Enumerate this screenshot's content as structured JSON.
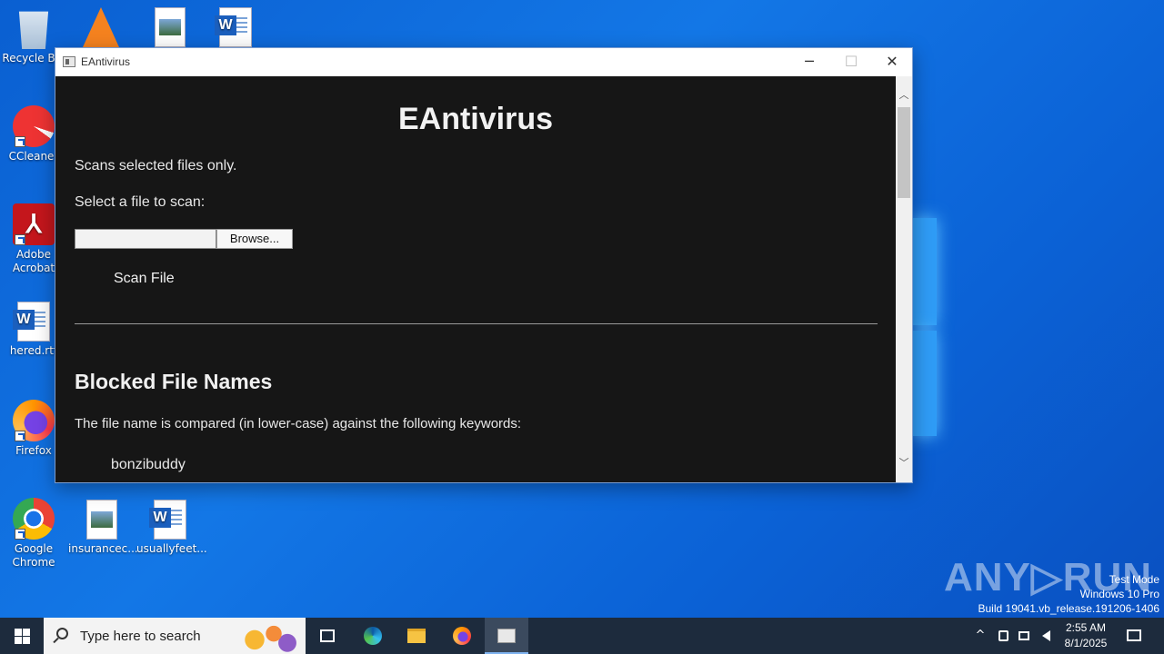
{
  "desktop": {
    "icons": [
      {
        "label": "Recycle Bin"
      },
      {
        "label": ""
      },
      {
        "label": ""
      },
      {
        "label": ""
      },
      {
        "label": "CCleaner"
      },
      {
        "label": "Adobe Acrobat"
      },
      {
        "label": "hered.rtf"
      },
      {
        "label": "Firefox"
      },
      {
        "label": "Google Chrome"
      },
      {
        "label": "insurancec..."
      },
      {
        "label": "usuallyfeet..."
      }
    ]
  },
  "window": {
    "title": "EAntivirus",
    "minimize_glyph": "─",
    "maximize_glyph": "☐",
    "close_glyph": "✕"
  },
  "app": {
    "title": "EAntivirus",
    "tagline": "Scans selected files only.",
    "select_label": "Select a file to scan:",
    "file_value": "",
    "browse_label": "Browse...",
    "scan_label": "Scan File",
    "blocked_heading": "Blocked File Names",
    "blocked_description": "The file name is compared (in lower-case) against the following keywords:",
    "keywords": [
      "bonzibuddy"
    ]
  },
  "scrollbar": {
    "up_glyph": "︿",
    "down_glyph": "﹀"
  },
  "watermark": {
    "text": "ANY▷RUN"
  },
  "system_info": {
    "line1": "Test Mode",
    "line2": "Windows 10 Pro",
    "line3": "Build 19041.vb_release.191206-1406"
  },
  "taskbar": {
    "search_placeholder": "Type here to search",
    "time": "2:55 AM",
    "date": "8/1/2025",
    "tray_chevron": "^"
  },
  "colors": {
    "desktop_blue": "#0b62d6",
    "app_background": "#161616",
    "taskbar": "#1d2b3d"
  }
}
